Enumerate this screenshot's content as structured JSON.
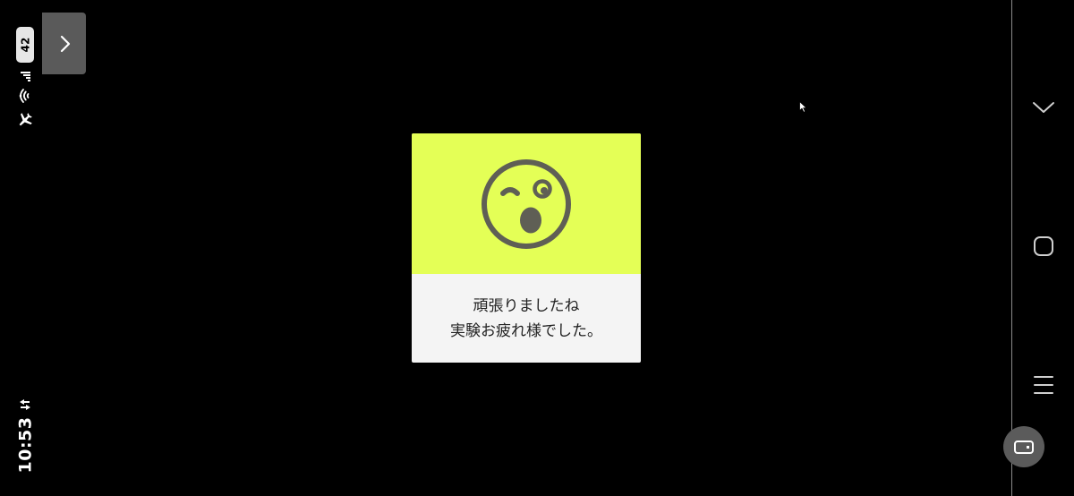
{
  "status_bar": {
    "battery_level": "42",
    "time": "10:53"
  },
  "dialog": {
    "line1": "頑張りましたね",
    "line2": "実験お疲れ様でした。"
  },
  "colors": {
    "dialog_accent": "#e4ff56",
    "face": "#5f5f55",
    "dialog_body": "#f4f4f4",
    "background": "#000000"
  },
  "icons": {
    "status": [
      "battery-icon",
      "signal-icon",
      "wifi-icon",
      "airplane-icon"
    ],
    "side_tab": "chevron-right-icon",
    "nav": [
      "chevron-down-icon",
      "home-icon",
      "menu-icon",
      "screen-rotate-icon"
    ],
    "dialog": "wink-face-icon"
  }
}
